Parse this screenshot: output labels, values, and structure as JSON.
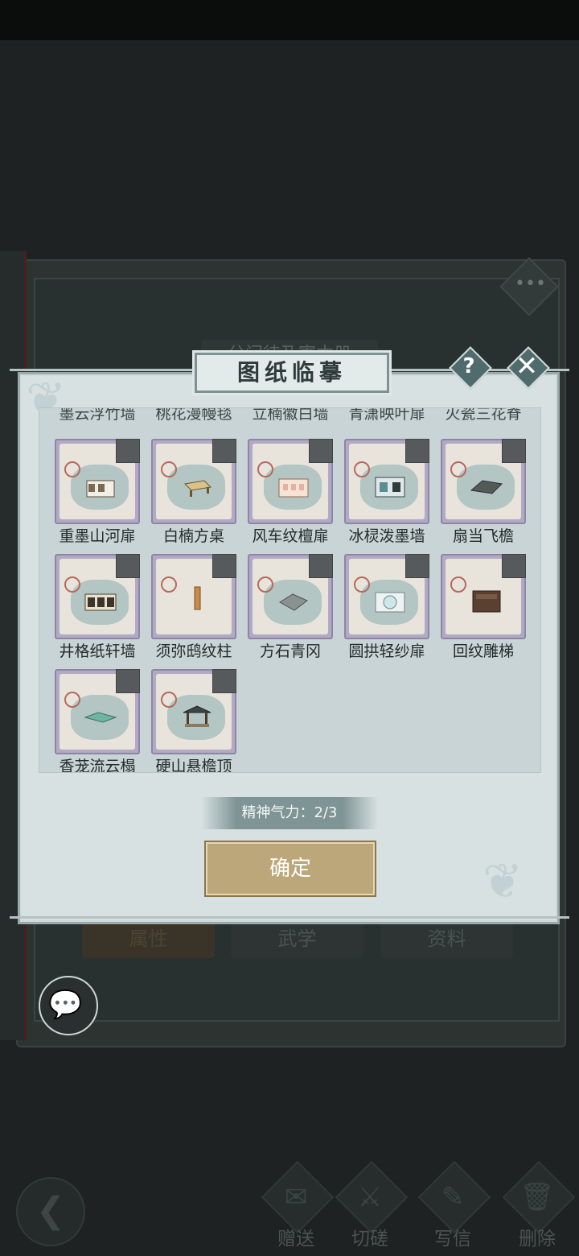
{
  "dialog": {
    "title": "图纸临摹",
    "help_glyph": "?",
    "close_glyph": "✕",
    "partial_row": [
      "墨云浮竹墙",
      "桃花漫幔毯",
      "立楠徽白墙",
      "青潇映叶扉",
      "火瓷三花脊"
    ],
    "items": [
      {
        "label": "重墨山河扉",
        "icon": "house-icon"
      },
      {
        "label": "白楠方桌",
        "icon": "table-icon"
      },
      {
        "label": "风车纹檀扉",
        "icon": "house-icon"
      },
      {
        "label": "冰棂泼墨墙",
        "icon": "wall-icon"
      },
      {
        "label": "扇当飞檐",
        "icon": "roof-icon"
      },
      {
        "label": "井格纸轩墙",
        "icon": "wall-icon"
      },
      {
        "label": "须弥鸱纹柱",
        "icon": "pillar-icon"
      },
      {
        "label": "方石青冈",
        "icon": "floor-icon"
      },
      {
        "label": "圆拱轻纱扉",
        "icon": "wall-icon"
      },
      {
        "label": "回纹雕梯",
        "icon": "stairs-icon"
      },
      {
        "label": "香茏流云榻",
        "icon": "bed-icon"
      },
      {
        "label": "硬山悬檐顶",
        "icon": "pavilion-icon"
      }
    ],
    "energy_text": "精神气力：2/3",
    "confirm_label": "确定"
  },
  "background": {
    "book_title": "分门徒及寄本册",
    "menu_glyph": "•••",
    "tabs": [
      "属性",
      "武学",
      "资料"
    ],
    "bottom_actions": [
      {
        "label": "赠送",
        "icon": "gift-icon"
      },
      {
        "label": "切磋",
        "icon": "sword-icon"
      },
      {
        "label": "写信",
        "icon": "letter-icon"
      },
      {
        "label": "删除",
        "icon": "trash-icon"
      }
    ]
  },
  "colors": {
    "dialog_bg": "#d7e1e2",
    "card_border": "#b2a9c4",
    "confirm_bg": "#bca77a",
    "title_text": "#2e3a3b"
  }
}
